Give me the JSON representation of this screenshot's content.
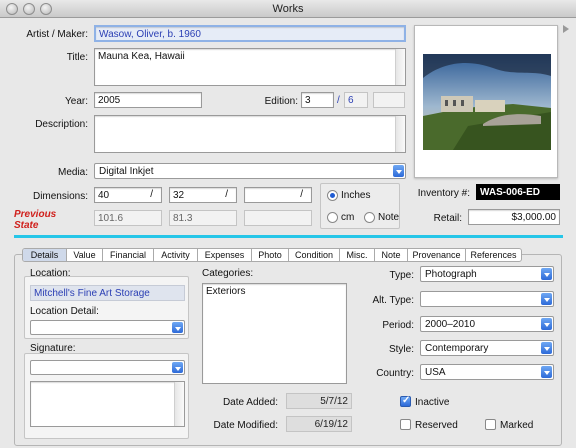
{
  "window": {
    "title": "Works"
  },
  "form": {
    "artist_label": "Artist / Maker:",
    "artist_value": "Wasow, Oliver, b. 1960",
    "title_label": "Title:",
    "title_value": "Mauna Kea, Hawaii",
    "year_label": "Year:",
    "year_value": "2005",
    "edition_label": "Edition:",
    "edition_num": "3",
    "edition_sep": "/",
    "edition_total": "6",
    "description_label": "Description:",
    "description_value": "",
    "media_label": "Media:",
    "media_value": "Digital Inkjet",
    "dimensions_label": "Dimensions:",
    "dim1": "40",
    "dim2": "32",
    "dim3": "",
    "dim_sep": "/",
    "prev_dim1": "101.6",
    "prev_dim2": "81.3",
    "prev_dim3": "",
    "previous_state_line1": "Previous",
    "previous_state_line2": "State",
    "unit_inches": "Inches",
    "unit_cm": "cm",
    "unit_note": "Note",
    "inventory_label": "Inventory #:",
    "inventory_value": "WAS-006-ED",
    "retail_label": "Retail:",
    "retail_value": "$3,000.00"
  },
  "tabs": [
    "Details",
    "Value",
    "Financial",
    "Activity",
    "Expenses",
    "Photo",
    "Condition",
    "Misc.",
    "Note",
    "Provenance",
    "References"
  ],
  "details": {
    "location_label": "Location:",
    "location_value": "Mitchell's Fine Art Storage",
    "location_detail_label": "Location Detail:",
    "location_detail_value": "",
    "signature_label": "Signature:",
    "signature_value": "",
    "categories_label": "Categories:",
    "categories_items": [
      "Exteriors"
    ],
    "date_added_label": "Date Added:",
    "date_added_value": "5/7/12",
    "date_modified_label": "Date Modified:",
    "date_modified_value": "6/19/12",
    "type_label": "Type:",
    "type_value": "Photograph",
    "alt_type_label": "Alt. Type:",
    "alt_type_value": "",
    "period_label": "Period:",
    "period_value": "2000–2010",
    "style_label": "Style:",
    "style_value": "Contemporary",
    "country_label": "Country:",
    "country_value": "USA",
    "inactive_label": "Inactive",
    "reserved_label": "Reserved",
    "marked_label": "Marked"
  },
  "colors": {
    "accent_line": "#26c6e8",
    "previous_state": "#d0201c",
    "link_blue": "#2b3fb4"
  }
}
